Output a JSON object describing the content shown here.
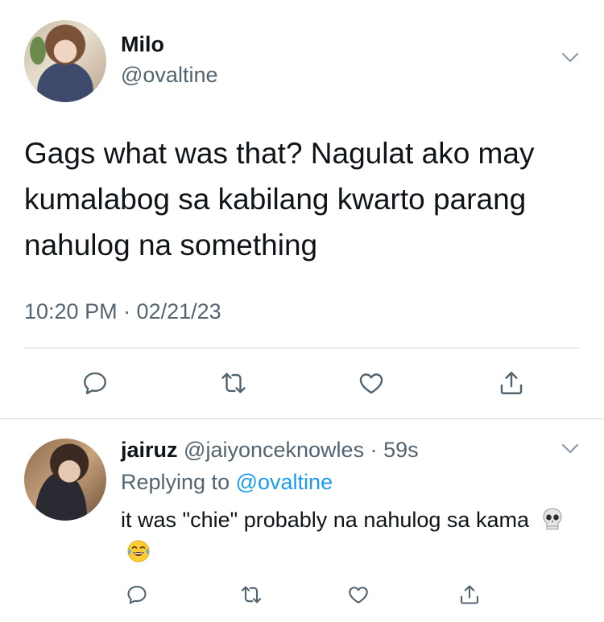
{
  "tweet": {
    "display_name": "Milo",
    "handle": "@ovaltine",
    "text": "Gags what was that? Nagulat ako may kumalabog sa kabilang kwarto parang nahulog na something",
    "timestamp": "10:20 PM · 02/21/23"
  },
  "reply": {
    "display_name": "jairuz",
    "handle": "@jaiyonceknowles",
    "time": "59s",
    "replying_prefix": "Replying to",
    "replying_to": "@ovaltine",
    "text": "it was \"chie\" probably na nahulog sa kama",
    "emojis": [
      "skull-emoji",
      "tears-of-joy-emoji"
    ]
  },
  "icons": {
    "actions": [
      "reply-icon",
      "retweet-icon",
      "like-icon",
      "share-icon"
    ],
    "menu": "chevron-down-icon"
  },
  "colors": {
    "text": "#0f1419",
    "secondary": "#536471",
    "accent": "#1d9bf0",
    "divider": "#cfd9de"
  }
}
